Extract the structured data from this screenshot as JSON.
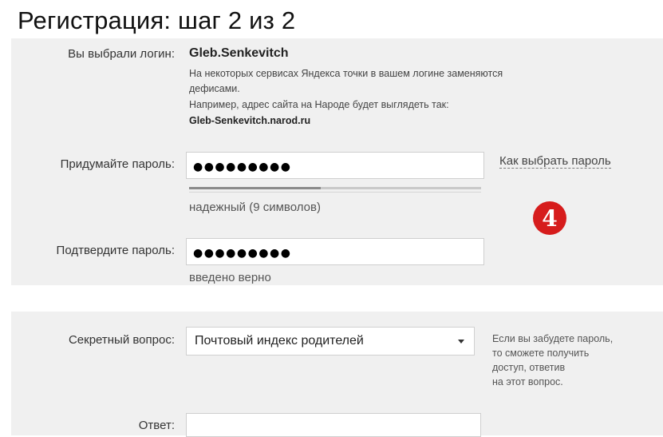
{
  "page": {
    "title": "Регистрация: шаг 2 из 2"
  },
  "login": {
    "label": "Вы выбрали логин:",
    "value": "Gleb.Senkevitch",
    "note_lines": [
      "На некоторых сервисах Яндекса точки в вашем логине заменяются",
      "дефисами.",
      "Например, адрес сайта на Народе будет выглядеть так:"
    ],
    "example_address": "Gleb-Senkevitch.narod.ru"
  },
  "password": {
    "label": "Придумайте пароль:",
    "masked_value": "●●●●●●●●●",
    "strength_text": "надежный (9 символов)",
    "strength_fraction": 0.45,
    "help_link": "Как выбрать пароль"
  },
  "step_badge": {
    "number": "4",
    "color": "#d61c1c"
  },
  "confirm": {
    "label": "Подтвердите пароль:",
    "masked_value": "●●●●●●●●●",
    "status": "введено верно"
  },
  "secret_question": {
    "label": "Секретный вопрос:",
    "selected": "Почтовый индекс родителей",
    "hint_lines": [
      "Если вы забудете пароль,",
      "то сможете получить",
      "доступ, ответив",
      "на этот вопрос."
    ]
  },
  "answer": {
    "label": "Ответ:",
    "value": ""
  }
}
